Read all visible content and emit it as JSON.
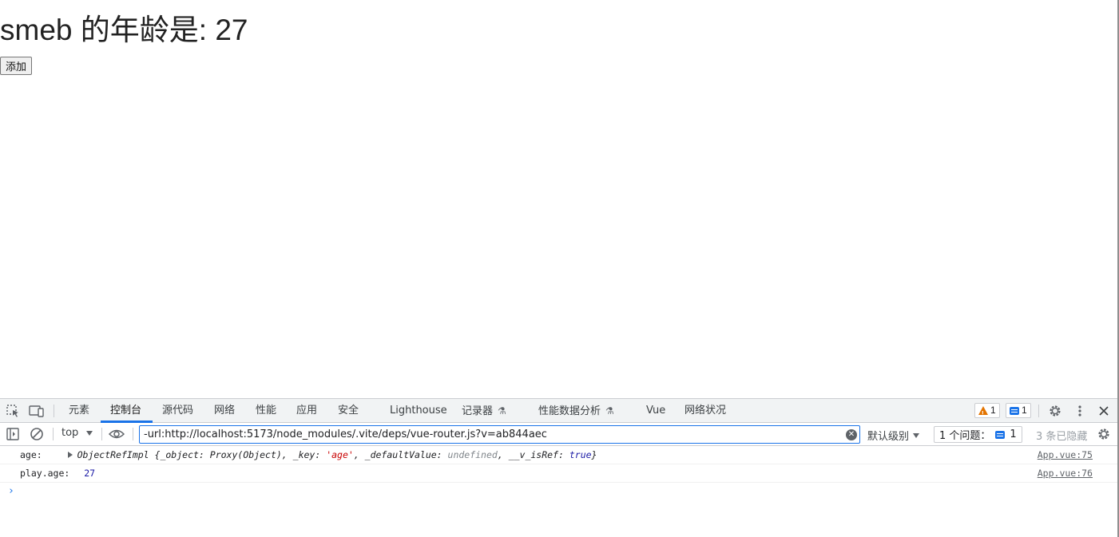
{
  "page": {
    "heading": "smeb 的年龄是: 27",
    "add_button": "添加"
  },
  "devtools": {
    "tabs": [
      "元素",
      "控制台",
      "源代码",
      "网络",
      "性能",
      "应用",
      "安全",
      "Lighthouse",
      "记录器",
      "性能数据分析",
      "Vue",
      "网络状况"
    ],
    "warn_count": "1",
    "info_count": "1",
    "toolbar": {
      "context": "top",
      "filter_value": "-url:http://localhost:5173/node_modules/.vite/deps/vue-router.js?v=ab844aec",
      "level": "默认级别",
      "issues_label": "1 个问题：",
      "issues_count": "1",
      "hidden": "3 条已隐藏"
    },
    "console": [
      {
        "label": "age:",
        "parts": {
          "type": "ObjectRefImpl",
          "open": "{_object: ",
          "proxy": "Proxy(Object)",
          "key_label": ", _key: ",
          "key": "'age'",
          "dv_label": ", _defaultValue: ",
          "dv": "undefined",
          "ref_label": ", __v_isRef: ",
          "ref": "true",
          "close": "}"
        },
        "source": "App.vue:75"
      },
      {
        "label": "play.age:",
        "value": "27",
        "source": "App.vue:76"
      }
    ],
    "prompt": "›"
  }
}
